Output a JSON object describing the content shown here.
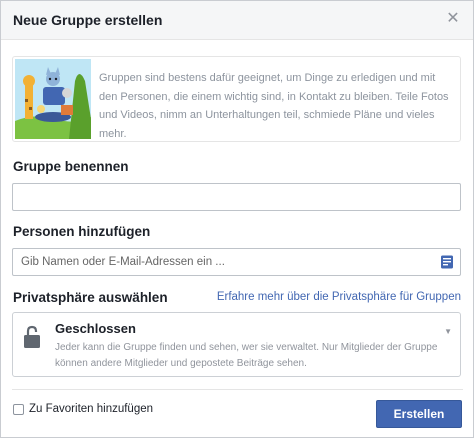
{
  "dialog": {
    "title": "Neue Gruppe erstellen",
    "close_icon": "close-icon"
  },
  "intro": {
    "illustration": "group-illustration",
    "text": "Gruppen sind bestens dafür geeignet, um Dinge zu erledigen und mit den Personen, die einem wichtig sind, in Kontakt zu bleiben. Teile Fotos und Videos, nimm an Unterhaltungen teil, schmiede Pläne und vieles mehr."
  },
  "name_section": {
    "label": "Gruppe benennen",
    "value": "",
    "placeholder": ""
  },
  "people_section": {
    "label": "Personen hinzufügen",
    "placeholder": "Gib Namen oder E-Mail-Adressen ein ...",
    "icon": "address-book-icon"
  },
  "privacy_section": {
    "label": "Privatsphäre auswählen",
    "learn_more": "Erfahre mehr über die Privatsphäre für Gruppen",
    "selected": {
      "title": "Geschlossen",
      "description": "Jeder kann die Gruppe finden und sehen, wer sie verwaltet. Nur Mitglieder der Gruppe können andere Mitglieder und gepostete Beiträge sehen.",
      "icon": "lock-icon"
    }
  },
  "footer": {
    "favorites_label": "Zu Favoriten hinzufügen",
    "favorites_checked": false,
    "create_label": "Erstellen"
  },
  "colors": {
    "primary": "#4267b2",
    "header_bg": "#f5f6f7",
    "text": "#1d2129",
    "muted": "#90949c"
  }
}
